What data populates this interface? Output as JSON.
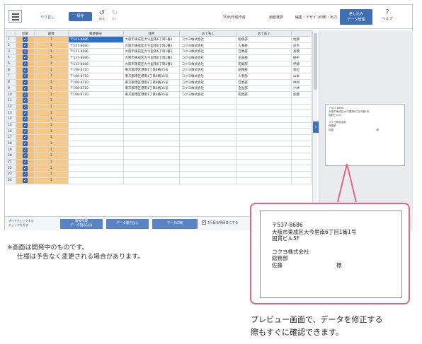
{
  "toolbar": {
    "undo_link": "やり直し",
    "save_label": "保存",
    "back_label": "戻る",
    "forward_label": "進む",
    "menu_top": "TOP/作成作成",
    "menu_paper": "用紙選択",
    "menu_edit": "編集・デザイン",
    "menu_print": "印刷・出力",
    "active_tab_l1": "差し込み",
    "active_tab_l2": "データ管理",
    "help_label": "ヘルプ"
  },
  "grid": {
    "headers": [
      "",
      "印刷",
      "部数",
      "郵便番号",
      "住所",
      "あて名１",
      "あて名２",
      ""
    ],
    "rows": [
      {
        "n": "1",
        "zip": "〒537-8686",
        "addr": "大阪市東成区大今里南6丁目1番1",
        "n1": "コクヨ株式会社",
        "n2": "総務部",
        "n3": "佐藤"
      },
      {
        "n": "2",
        "zip": "〒537-8686",
        "addr": "大阪市東成区大今里南6丁目1番1",
        "n1": "コクヨ株式会社",
        "n2": "人事部",
        "n3": "鈴木"
      },
      {
        "n": "3",
        "zip": "〒537-8686",
        "addr": "大阪市東成区大今里南6丁目1番1",
        "n1": "コクヨ株式会社",
        "n2": "営業部",
        "n3": "高橋"
      },
      {
        "n": "4",
        "zip": "〒537-8686",
        "addr": "大阪市東成区大今里南6丁目1番1",
        "n1": "コクヨ株式会社",
        "n2": "企画部",
        "n3": "田中"
      },
      {
        "n": "5",
        "zip": "〒537-8686",
        "addr": "大阪市東成区大今里南6丁目1番1",
        "n1": "コクヨ株式会社",
        "n2": "開発部",
        "n3": "伊藤"
      },
      {
        "n": "6",
        "zip": "〒108-8710",
        "addr": "東京都港区港南1丁目8番35号",
        "n1": "コクヨ株式会社",
        "n2": "総務部",
        "n3": "渡辺"
      },
      {
        "n": "7",
        "zip": "〒108-8710",
        "addr": "東京都港区港南1丁目8番35号",
        "n1": "コクヨ株式会社",
        "n2": "人事部",
        "n3": "山本"
      },
      {
        "n": "8",
        "zip": "〒108-8710",
        "addr": "東京都港区港南1丁目8番35号",
        "n1": "コクヨ株式会社",
        "n2": "営業部",
        "n3": "中村"
      },
      {
        "n": "9",
        "zip": "〒108-8710",
        "addr": "東京都港区港南1丁目8番35号",
        "n1": "コクヨ株式会社",
        "n2": "企画部",
        "n3": "小林"
      },
      {
        "n": "10",
        "zip": "〒108-8710",
        "addr": "東京都港区港南1丁目8番35号",
        "n1": "コクヨ株式会社",
        "n2": "開発部",
        "n3": "加藤"
      },
      {
        "n": "11",
        "zip": "",
        "addr": "",
        "n1": "",
        "n2": "",
        "n3": ""
      },
      {
        "n": "12",
        "zip": "",
        "addr": "",
        "n1": "",
        "n2": "",
        "n3": ""
      },
      {
        "n": "13",
        "zip": "",
        "addr": "",
        "n1": "",
        "n2": "",
        "n3": ""
      },
      {
        "n": "14",
        "zip": "",
        "addr": "",
        "n1": "",
        "n2": "",
        "n3": ""
      },
      {
        "n": "15",
        "zip": "",
        "addr": "",
        "n1": "",
        "n2": "",
        "n3": ""
      },
      {
        "n": "16",
        "zip": "",
        "addr": "",
        "n1": "",
        "n2": "",
        "n3": ""
      },
      {
        "n": "17",
        "zip": "",
        "addr": "",
        "n1": "",
        "n2": "",
        "n3": ""
      },
      {
        "n": "18",
        "zip": "",
        "addr": "",
        "n1": "",
        "n2": "",
        "n3": ""
      },
      {
        "n": "19",
        "zip": "",
        "addr": "",
        "n1": "",
        "n2": "",
        "n3": ""
      },
      {
        "n": "20",
        "zip": "",
        "addr": "",
        "n1": "",
        "n2": "",
        "n3": ""
      },
      {
        "n": "21",
        "zip": "",
        "addr": "",
        "n1": "",
        "n2": "",
        "n3": ""
      },
      {
        "n": "22",
        "zip": "",
        "addr": "",
        "n1": "",
        "n2": "",
        "n3": ""
      },
      {
        "n": "23",
        "zip": "",
        "addr": "",
        "n1": "",
        "n2": "",
        "n3": ""
      },
      {
        "n": "24",
        "zip": "",
        "addr": "",
        "n1": "",
        "n2": "",
        "n3": ""
      }
    ],
    "copies": "1",
    "checked": true,
    "selected_row": 1
  },
  "bottom": {
    "hint_line1": "すべてチェックする",
    "hint_line2": "チェックを外す",
    "btn_import_l1": "新規作成",
    "btn_import_l2": "データ読み込み",
    "btn_export": "データ書き出し",
    "btn_print": "データ印刷",
    "header_checkbox_label": "1行目を項目名にする"
  },
  "mini_preview": {
    "lines": [
      "〒537-8686",
      "大阪市東成区大今里南6丁目1番1号",
      "国貫ビル5F",
      "",
      "コクヨ株式会社",
      "総務部"
    ],
    "name": "佐藤",
    "honorific": "様"
  },
  "big_preview": {
    "zip": "〒537-8686",
    "addr1": "大阪市東成区大今里南6丁目1番1号",
    "addr2": "国貫ビル5F",
    "company": "コクヨ株式会社",
    "dept": "総務部",
    "name": "佐藤",
    "honorific": "様"
  },
  "note": {
    "line1": "※画面は開発中のものです。",
    "line2": "仕様は予告なく変更される場合があります。"
  },
  "caption": {
    "line1": "プレビュー画面で、データを修正する",
    "line2": "際もすぐに確認できます。"
  },
  "colors": {
    "accent": "#3f6fb5",
    "callout": "#e5647f",
    "check_column": "#f2c17c"
  },
  "icons": [
    "menu-icon",
    "undo-icon",
    "redo-icon",
    "help-icon",
    "check-icon",
    "chevron-right-icon"
  ]
}
